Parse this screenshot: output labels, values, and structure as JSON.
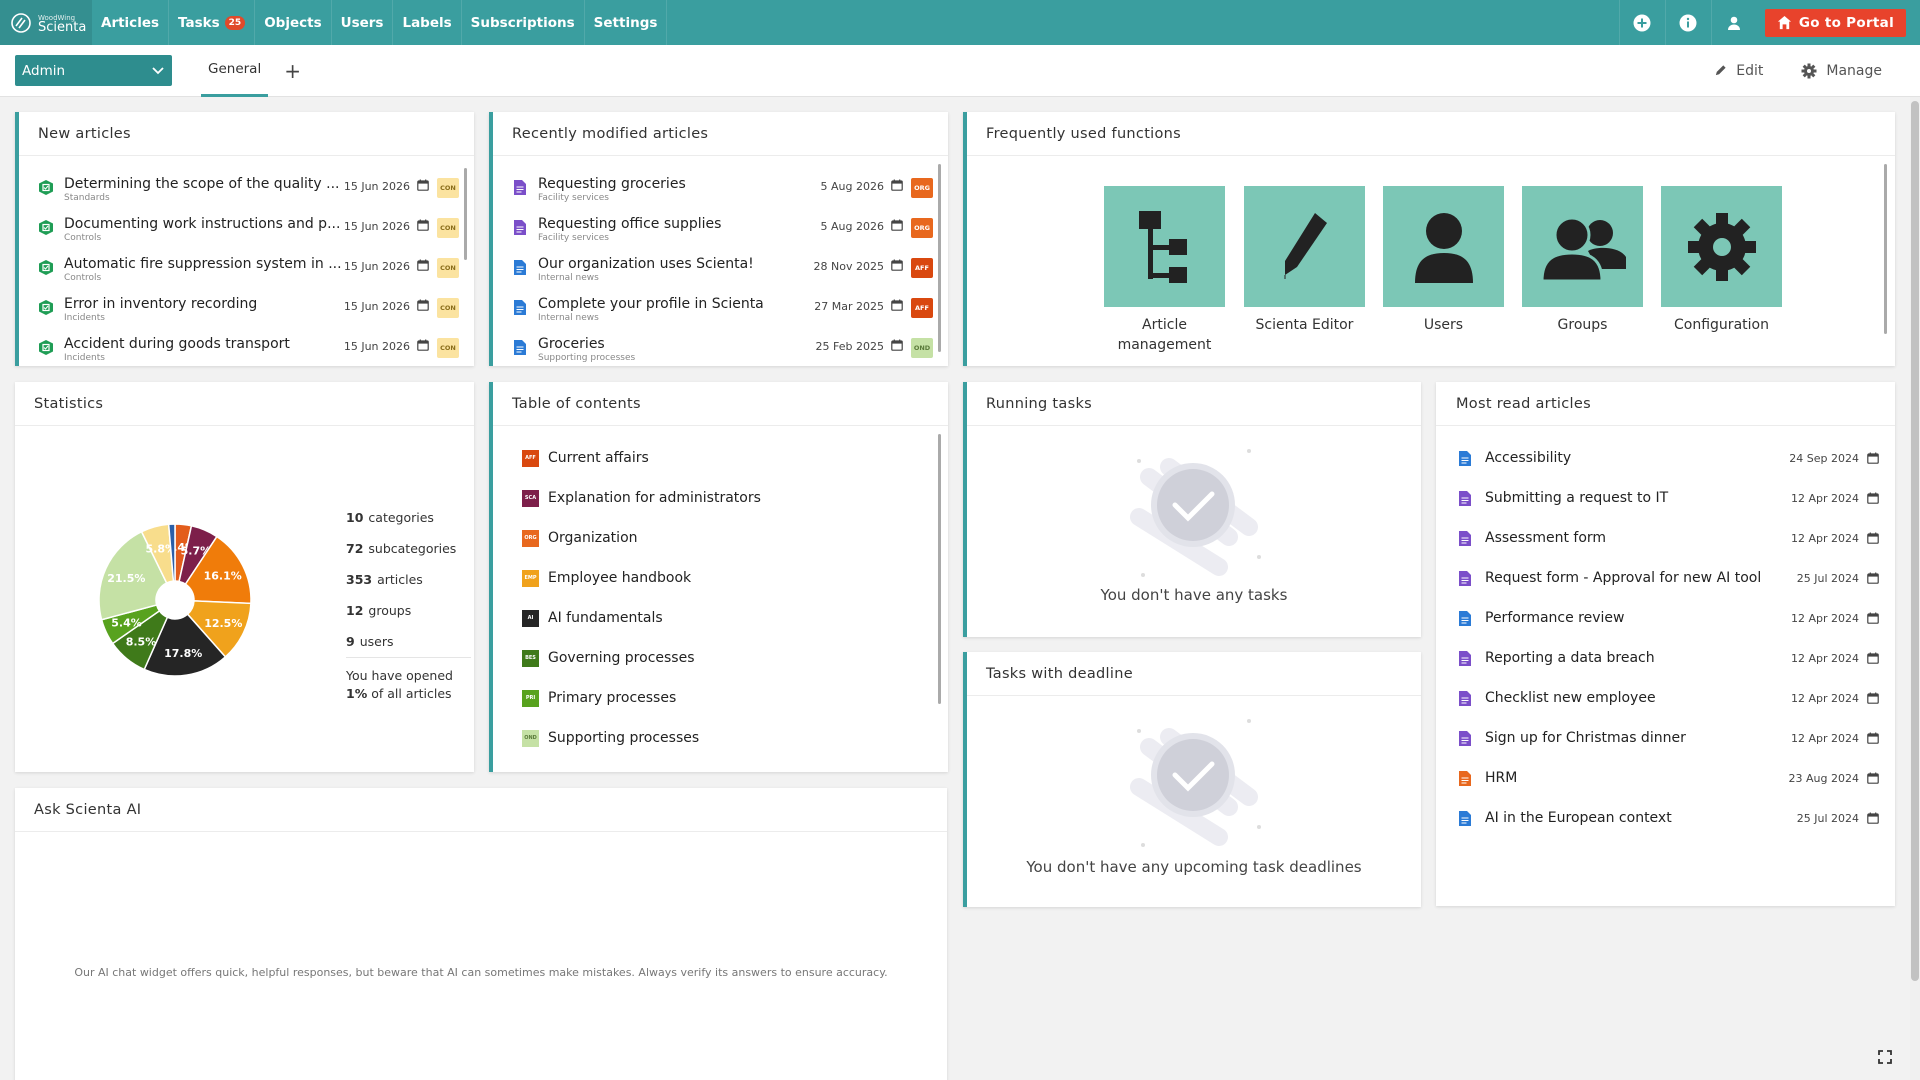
{
  "brand": {
    "top": "WoodWing",
    "name": "Scienta"
  },
  "nav": [
    {
      "label": "Articles"
    },
    {
      "label": "Tasks",
      "badge": "25"
    },
    {
      "label": "Objects"
    },
    {
      "label": "Users"
    },
    {
      "label": "Labels"
    },
    {
      "label": "Subscriptions"
    },
    {
      "label": "Settings"
    }
  ],
  "portal_button": "Go to Portal",
  "role": "Admin",
  "tabs": {
    "general": "General",
    "add": "+"
  },
  "actions": {
    "edit": "Edit",
    "manage": "Manage"
  },
  "new_articles": {
    "title": "New articles",
    "items": [
      {
        "title": "Determining the scope of the quality ...",
        "sub": "Standards",
        "date": "15 Jun 2026",
        "tag": "CON"
      },
      {
        "title": "Documenting work instructions and p...",
        "sub": "Controls",
        "date": "15 Jun 2026",
        "tag": "CON"
      },
      {
        "title": "Automatic fire suppression system in ...",
        "sub": "Controls",
        "date": "15 Jun 2026",
        "tag": "CON"
      },
      {
        "title": "Error in inventory recording",
        "sub": "Incidents",
        "date": "15 Jun 2026",
        "tag": "CON"
      },
      {
        "title": "Accident during goods transport",
        "sub": "Incidents",
        "date": "15 Jun 2026",
        "tag": "CON"
      }
    ]
  },
  "recent_articles": {
    "title": "Recently modified articles",
    "items": [
      {
        "title": "Requesting groceries",
        "sub": "Facility services",
        "date": "5 Aug 2026",
        "tag": "ORG",
        "color": "#7b4fc9",
        "tagbg": "#e8681e"
      },
      {
        "title": "Requesting office supplies",
        "sub": "Facility services",
        "date": "5 Aug 2026",
        "tag": "ORG",
        "color": "#7b4fc9",
        "tagbg": "#e8681e"
      },
      {
        "title": "Our organization uses Scienta!",
        "sub": "Internal news",
        "date": "28 Nov 2025",
        "tag": "AFF",
        "color": "#2b7bd6",
        "tagbg": "#d9480f"
      },
      {
        "title": "Complete your profile in Scienta",
        "sub": "Internal news",
        "date": "27 Mar 2025",
        "tag": "AFF",
        "color": "#2b7bd6",
        "tagbg": "#d9480f"
      },
      {
        "title": "Groceries",
        "sub": "Supporting processes",
        "date": "25 Feb 2025",
        "tag": "OND",
        "color": "#2b7bd6",
        "tagbg": "#c5e1a5"
      }
    ]
  },
  "functions": {
    "title": "Frequently used functions",
    "items": [
      {
        "label": "Article management",
        "icon": "hierarchy-icon"
      },
      {
        "label": "Scienta Editor",
        "icon": "pencil-icon"
      },
      {
        "label": "Users",
        "icon": "user-icon"
      },
      {
        "label": "Groups",
        "icon": "group-icon"
      },
      {
        "label": "Configuration",
        "icon": "gear-icon"
      }
    ]
  },
  "statistics": {
    "title": "Statistics",
    "stats": [
      {
        "num": "10",
        "label": "categories"
      },
      {
        "num": "72",
        "label": "subcategories"
      },
      {
        "num": "353",
        "label": "articles"
      },
      {
        "num": "12",
        "label": "groups"
      },
      {
        "num": "9",
        "label": "users"
      }
    ],
    "opened_prefix": "You have opened",
    "opened_pct": "1%",
    "opened_suffix": "of all articles"
  },
  "chart_data": {
    "type": "pie",
    "values": [
      3.4,
      5.7,
      16.1,
      12.5,
      17.8,
      8.5,
      5.4,
      21.5,
      5.8,
      1.3
    ],
    "colors": [
      "#e35d1c",
      "#7d1f4a",
      "#f07c0a",
      "#f0a21c",
      "#252525",
      "#3f7a1a",
      "#58a21e",
      "#c5e1a5",
      "#f8dd8c",
      "#2b5fa8"
    ],
    "labels": [
      "3.4%",
      "5.7%",
      "16.1%",
      "12.5%",
      "17.8%",
      "8.5%",
      "5.4%",
      "21.5%",
      "5.8%",
      ""
    ]
  },
  "toc": {
    "title": "Table of contents",
    "items": [
      {
        "label": "Current affairs",
        "code": "AFF",
        "color": "#d9480f"
      },
      {
        "label": "Explanation for administrators",
        "code": "SCA",
        "color": "#7d1f4a"
      },
      {
        "label": "Organization",
        "code": "ORG",
        "color": "#e8681e"
      },
      {
        "label": "Employee handbook",
        "code": "EMP",
        "color": "#f0a21c"
      },
      {
        "label": "AI fundamentals",
        "code": "AI",
        "color": "#252525"
      },
      {
        "label": "Governing processes",
        "code": "BES",
        "color": "#3f7a1a"
      },
      {
        "label": "Primary processes",
        "code": "PRI",
        "color": "#58a21e"
      },
      {
        "label": "Supporting processes",
        "code": "OND",
        "color": "#c5e1a5"
      }
    ]
  },
  "running_tasks": {
    "title": "Running tasks",
    "empty": "You don't have any tasks"
  },
  "deadline_tasks": {
    "title": "Tasks with deadline",
    "empty": "You don't have any upcoming task deadlines"
  },
  "most_read": {
    "title": "Most read articles",
    "items": [
      {
        "title": "Accessibility",
        "date": "24 Sep 2024",
        "color": "#2b7bd6"
      },
      {
        "title": "Submitting a request to IT",
        "date": "12 Apr 2024",
        "color": "#7b4fc9"
      },
      {
        "title": "Assessment form",
        "date": "12 Apr 2024",
        "color": "#7b4fc9"
      },
      {
        "title": "Request form - Approval for new AI tool",
        "date": "25 Jul 2024",
        "color": "#7b4fc9"
      },
      {
        "title": "Performance review",
        "date": "12 Apr 2024",
        "color": "#2b7bd6"
      },
      {
        "title": "Reporting a data breach",
        "date": "12 Apr 2024",
        "color": "#7b4fc9"
      },
      {
        "title": "Checklist new employee",
        "date": "12 Apr 2024",
        "color": "#7b4fc9"
      },
      {
        "title": "Sign up for Christmas dinner",
        "date": "12 Apr 2024",
        "color": "#7b4fc9"
      },
      {
        "title": "HRM",
        "date": "23 Aug 2024",
        "color": "#e8681e"
      },
      {
        "title": "AI in the European context",
        "date": "25 Jul 2024",
        "color": "#2b7bd6"
      }
    ]
  },
  "ai": {
    "title": "Ask Scienta AI",
    "note": "Our AI chat widget offers quick, helpful responses, but beware that AI can sometimes make mistakes. Always verify its answers to ensure accuracy."
  }
}
